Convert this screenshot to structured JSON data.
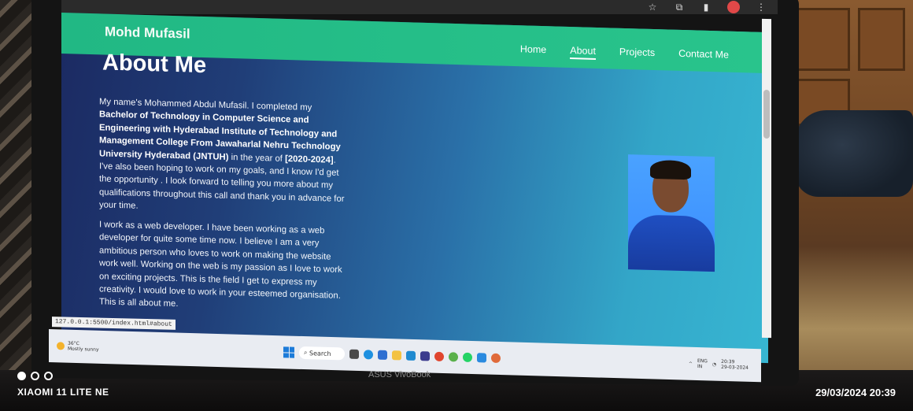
{
  "site": {
    "brand": "Mohd Mufasil",
    "nav": [
      {
        "label": "Home",
        "active": false
      },
      {
        "label": "About",
        "active": true
      },
      {
        "label": "Projects",
        "active": false
      },
      {
        "label": "Contact Me",
        "active": false
      }
    ],
    "about": {
      "heading": "About Me",
      "para1_a": "My name's Mohammed Abdul Mufasil. I completed my ",
      "para1_b": "Bachelor of Technology in Computer Science and Engineering with Hyderabad Institute of Technology and Management College From Jawaharlal Nehru Technology University Hyderabad (JNTUH)",
      "para1_c": " in the year of ",
      "para1_d": "[2020-2024]",
      "para1_e": ". I've also been hoping to work on my goals, and I know I'd get the opportunity . I look forward to telling you more about my qualifications throughout this call and thank you in advance for your time.",
      "para2": "I work as a web developer. I have been working as a web developer for quite some time now. I believe I am a very ambitious person who loves to work on making the website work well. Working on the web is my passion as I love to work on exciting projects. This is the field I get to express my creativity. I would love to work in your esteemed organisation. This is all about me."
    }
  },
  "browser": {
    "status_url": "127.0.0.1:5500/index.html#about"
  },
  "taskbar": {
    "weather_temp": "36°C",
    "weather_desc": "Mostly sunny",
    "search_label": "Search",
    "lang": "ENG",
    "lang_region": "IN",
    "time": "20:39",
    "date": "29-03-2024"
  },
  "device": {
    "laptop_brand": "ASUS VivoBook"
  },
  "photo_overlay": {
    "camera_label": "XIAOMI 11 LITE NE",
    "timestamp": "29/03/2024  20:39"
  },
  "colors": {
    "navbar": "#22b986",
    "page_gradient_start": "#1b2a62",
    "page_gradient_end": "#37b6d2"
  }
}
